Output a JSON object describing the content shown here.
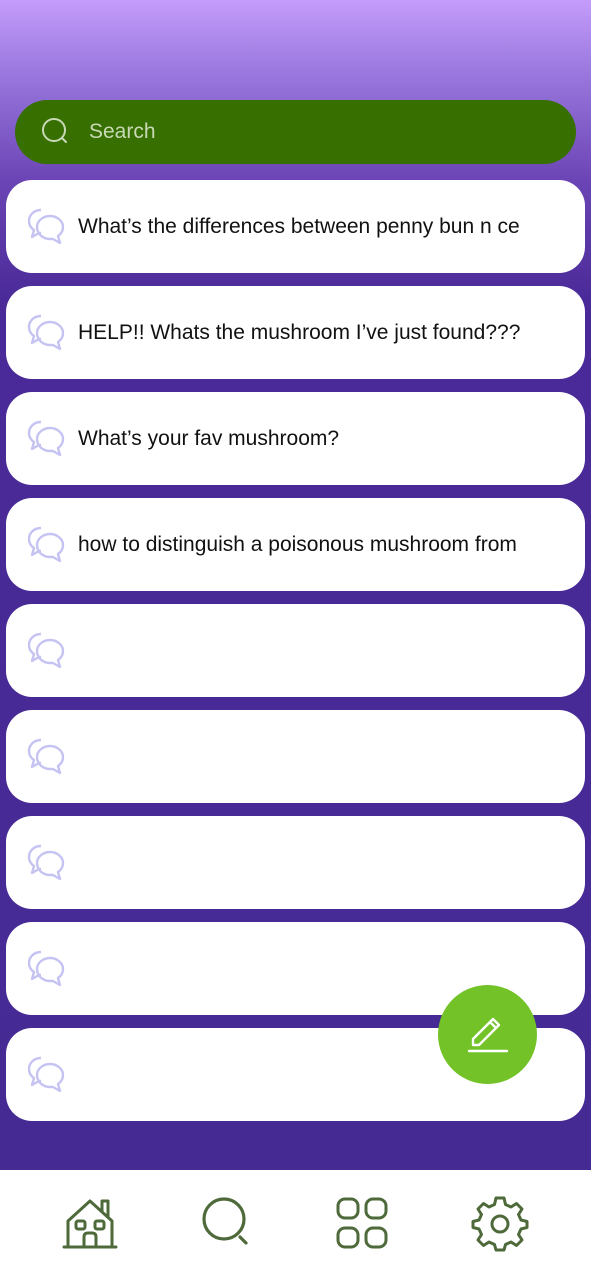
{
  "search": {
    "placeholder": "Search",
    "icon": "search-icon"
  },
  "threads": [
    {
      "title": "What’s the differences between penny bun n ce",
      "icon": "chat-bubbles-icon"
    },
    {
      "title": "HELP!! Whats the mushroom I’ve just found???",
      "icon": "chat-bubbles-icon"
    },
    {
      "title": "What’s your fav mushroom?",
      "icon": "chat-bubbles-icon"
    },
    {
      "title": "how to distinguish a poisonous mushroom from",
      "icon": "chat-bubbles-icon"
    },
    {
      "title": "",
      "icon": "chat-bubbles-icon"
    },
    {
      "title": "",
      "icon": "chat-bubbles-icon"
    },
    {
      "title": "",
      "icon": "chat-bubbles-icon"
    },
    {
      "title": "",
      "icon": "chat-bubbles-icon"
    },
    {
      "title": "",
      "icon": "chat-bubbles-icon"
    }
  ],
  "fab": {
    "icon": "pencil-icon"
  },
  "nav": [
    {
      "id": "home",
      "icon": "home-icon"
    },
    {
      "id": "search",
      "icon": "search-icon"
    },
    {
      "id": "apps",
      "icon": "grid-icon"
    },
    {
      "id": "settings",
      "icon": "gear-icon"
    }
  ],
  "colors": {
    "background_top": "#c49cfb",
    "background_bottom": "#452a94",
    "search_bar": "#376f00",
    "fab": "#73c228",
    "nav_icons": "#4f6a3a",
    "chat_icon": "#c5c3f2"
  }
}
